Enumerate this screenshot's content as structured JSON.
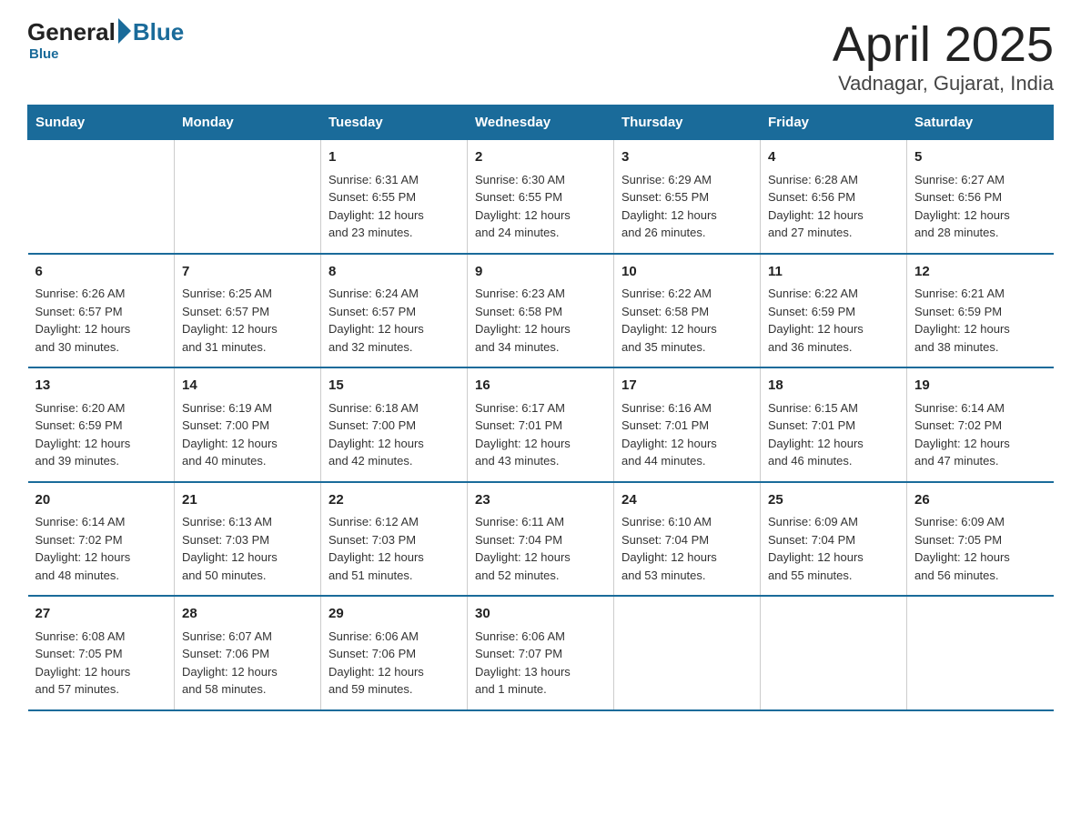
{
  "header": {
    "logo_general": "General",
    "logo_blue": "Blue",
    "month": "April 2025",
    "location": "Vadnagar, Gujarat, India"
  },
  "days_of_week": [
    "Sunday",
    "Monday",
    "Tuesday",
    "Wednesday",
    "Thursday",
    "Friday",
    "Saturday"
  ],
  "weeks": [
    [
      {
        "day": "",
        "info": ""
      },
      {
        "day": "",
        "info": ""
      },
      {
        "day": "1",
        "info": "Sunrise: 6:31 AM\nSunset: 6:55 PM\nDaylight: 12 hours\nand 23 minutes."
      },
      {
        "day": "2",
        "info": "Sunrise: 6:30 AM\nSunset: 6:55 PM\nDaylight: 12 hours\nand 24 minutes."
      },
      {
        "day": "3",
        "info": "Sunrise: 6:29 AM\nSunset: 6:55 PM\nDaylight: 12 hours\nand 26 minutes."
      },
      {
        "day": "4",
        "info": "Sunrise: 6:28 AM\nSunset: 6:56 PM\nDaylight: 12 hours\nand 27 minutes."
      },
      {
        "day": "5",
        "info": "Sunrise: 6:27 AM\nSunset: 6:56 PM\nDaylight: 12 hours\nand 28 minutes."
      }
    ],
    [
      {
        "day": "6",
        "info": "Sunrise: 6:26 AM\nSunset: 6:57 PM\nDaylight: 12 hours\nand 30 minutes."
      },
      {
        "day": "7",
        "info": "Sunrise: 6:25 AM\nSunset: 6:57 PM\nDaylight: 12 hours\nand 31 minutes."
      },
      {
        "day": "8",
        "info": "Sunrise: 6:24 AM\nSunset: 6:57 PM\nDaylight: 12 hours\nand 32 minutes."
      },
      {
        "day": "9",
        "info": "Sunrise: 6:23 AM\nSunset: 6:58 PM\nDaylight: 12 hours\nand 34 minutes."
      },
      {
        "day": "10",
        "info": "Sunrise: 6:22 AM\nSunset: 6:58 PM\nDaylight: 12 hours\nand 35 minutes."
      },
      {
        "day": "11",
        "info": "Sunrise: 6:22 AM\nSunset: 6:59 PM\nDaylight: 12 hours\nand 36 minutes."
      },
      {
        "day": "12",
        "info": "Sunrise: 6:21 AM\nSunset: 6:59 PM\nDaylight: 12 hours\nand 38 minutes."
      }
    ],
    [
      {
        "day": "13",
        "info": "Sunrise: 6:20 AM\nSunset: 6:59 PM\nDaylight: 12 hours\nand 39 minutes."
      },
      {
        "day": "14",
        "info": "Sunrise: 6:19 AM\nSunset: 7:00 PM\nDaylight: 12 hours\nand 40 minutes."
      },
      {
        "day": "15",
        "info": "Sunrise: 6:18 AM\nSunset: 7:00 PM\nDaylight: 12 hours\nand 42 minutes."
      },
      {
        "day": "16",
        "info": "Sunrise: 6:17 AM\nSunset: 7:01 PM\nDaylight: 12 hours\nand 43 minutes."
      },
      {
        "day": "17",
        "info": "Sunrise: 6:16 AM\nSunset: 7:01 PM\nDaylight: 12 hours\nand 44 minutes."
      },
      {
        "day": "18",
        "info": "Sunrise: 6:15 AM\nSunset: 7:01 PM\nDaylight: 12 hours\nand 46 minutes."
      },
      {
        "day": "19",
        "info": "Sunrise: 6:14 AM\nSunset: 7:02 PM\nDaylight: 12 hours\nand 47 minutes."
      }
    ],
    [
      {
        "day": "20",
        "info": "Sunrise: 6:14 AM\nSunset: 7:02 PM\nDaylight: 12 hours\nand 48 minutes."
      },
      {
        "day": "21",
        "info": "Sunrise: 6:13 AM\nSunset: 7:03 PM\nDaylight: 12 hours\nand 50 minutes."
      },
      {
        "day": "22",
        "info": "Sunrise: 6:12 AM\nSunset: 7:03 PM\nDaylight: 12 hours\nand 51 minutes."
      },
      {
        "day": "23",
        "info": "Sunrise: 6:11 AM\nSunset: 7:04 PM\nDaylight: 12 hours\nand 52 minutes."
      },
      {
        "day": "24",
        "info": "Sunrise: 6:10 AM\nSunset: 7:04 PM\nDaylight: 12 hours\nand 53 minutes."
      },
      {
        "day": "25",
        "info": "Sunrise: 6:09 AM\nSunset: 7:04 PM\nDaylight: 12 hours\nand 55 minutes."
      },
      {
        "day": "26",
        "info": "Sunrise: 6:09 AM\nSunset: 7:05 PM\nDaylight: 12 hours\nand 56 minutes."
      }
    ],
    [
      {
        "day": "27",
        "info": "Sunrise: 6:08 AM\nSunset: 7:05 PM\nDaylight: 12 hours\nand 57 minutes."
      },
      {
        "day": "28",
        "info": "Sunrise: 6:07 AM\nSunset: 7:06 PM\nDaylight: 12 hours\nand 58 minutes."
      },
      {
        "day": "29",
        "info": "Sunrise: 6:06 AM\nSunset: 7:06 PM\nDaylight: 12 hours\nand 59 minutes."
      },
      {
        "day": "30",
        "info": "Sunrise: 6:06 AM\nSunset: 7:07 PM\nDaylight: 13 hours\nand 1 minute."
      },
      {
        "day": "",
        "info": ""
      },
      {
        "day": "",
        "info": ""
      },
      {
        "day": "",
        "info": ""
      }
    ]
  ]
}
